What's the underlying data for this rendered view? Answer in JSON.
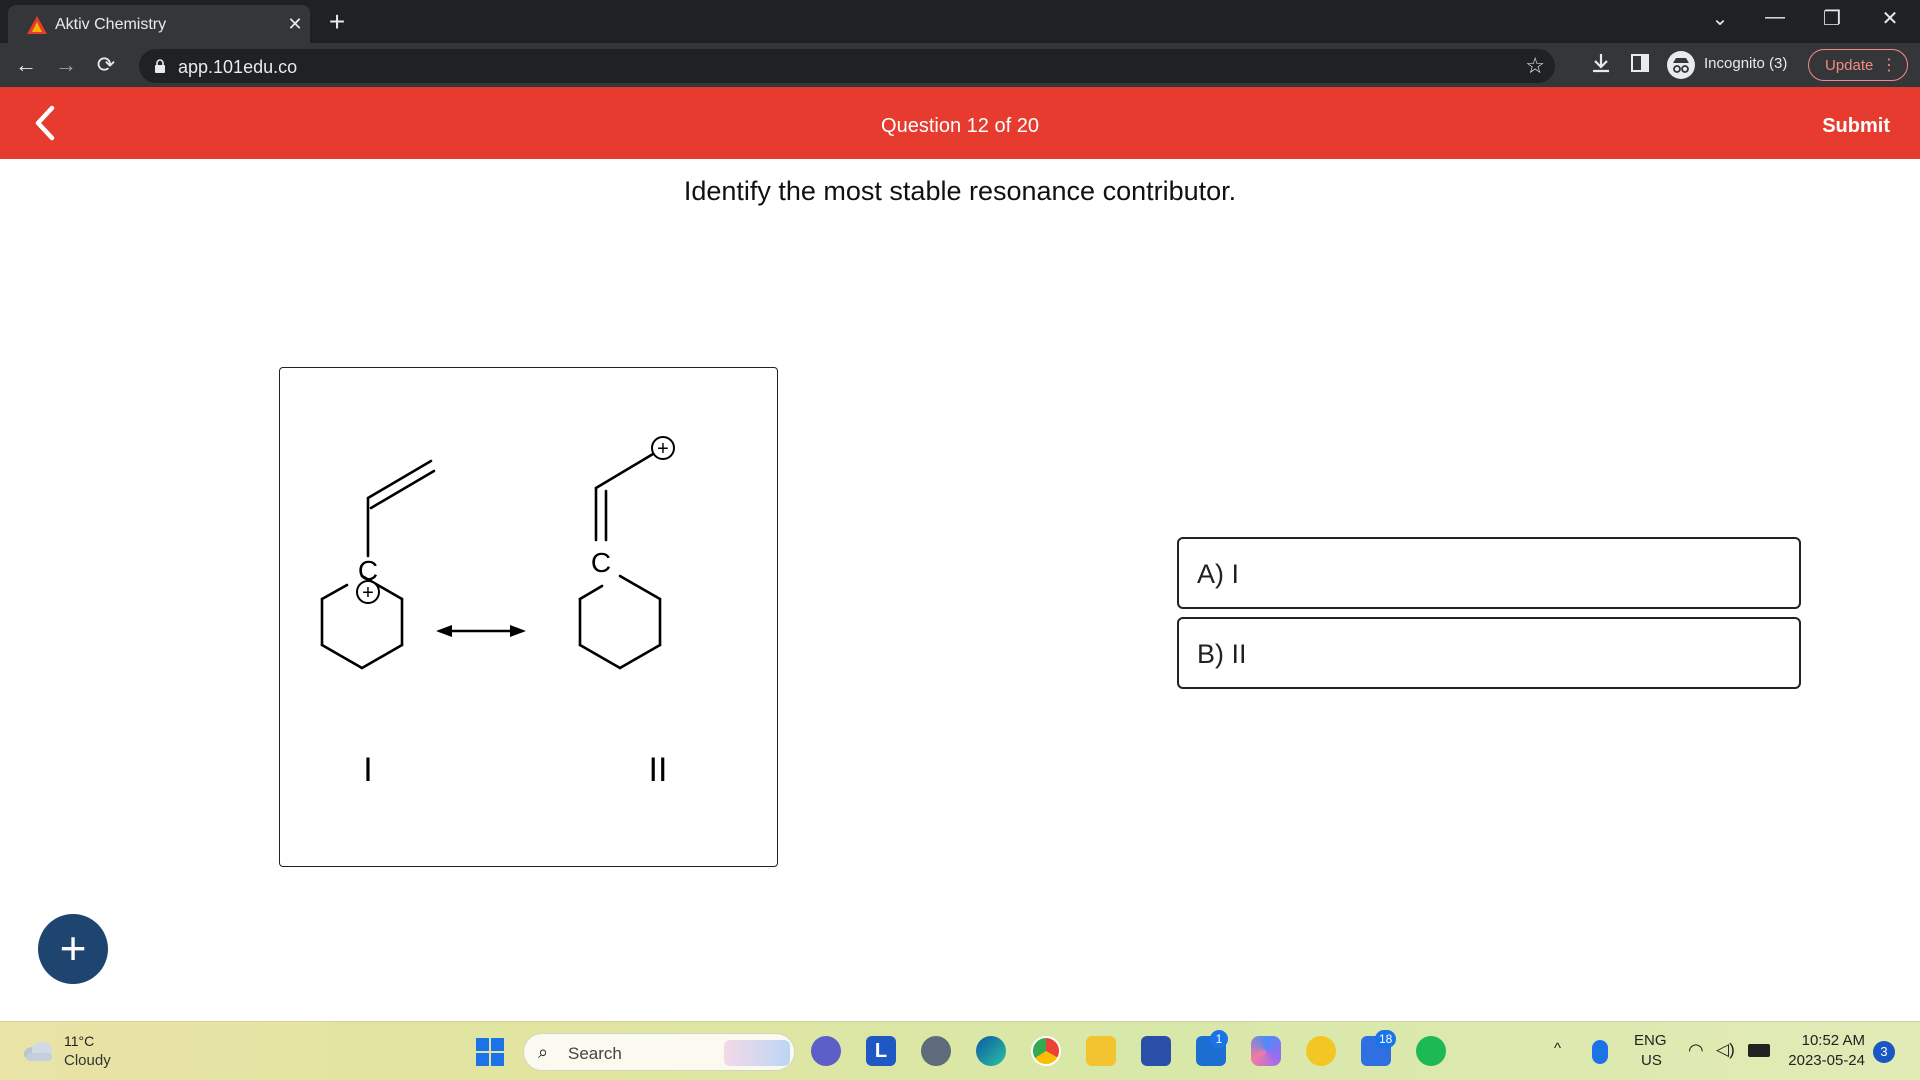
{
  "browser": {
    "tab_title": "Aktiv Chemistry",
    "tab_close": "✕",
    "new_tab": "+",
    "url": "app.101edu.co",
    "incognito_label": "Incognito (3)",
    "update_label": "Update",
    "window_controls": {
      "menu": "⌄",
      "minimize": "—",
      "restore": "❐",
      "close": "✕"
    }
  },
  "header": {
    "question_counter": "Question 12 of 20",
    "submit_label": "Submit",
    "color": "#e63b2e"
  },
  "question": {
    "prompt": "Identify the most stable resonance contributor.",
    "figure": {
      "atom_label_c": "C",
      "charge_symbol": "+",
      "label_i": "I",
      "label_ii": "II"
    },
    "choices": [
      {
        "label": "A) I"
      },
      {
        "label": "B) II"
      }
    ]
  },
  "fab": {
    "label": "+",
    "color": "#1d4570"
  },
  "taskbar": {
    "weather_temp": "11°C",
    "weather_desc": "Cloudy",
    "search_label": "Search",
    "badge_mail": "1",
    "badge_teams": "18",
    "language_top": "ENG",
    "language_bottom": "US",
    "time": "10:52 AM",
    "date": "2023-05-24",
    "notifications": "3",
    "tray_chevron": "^"
  }
}
